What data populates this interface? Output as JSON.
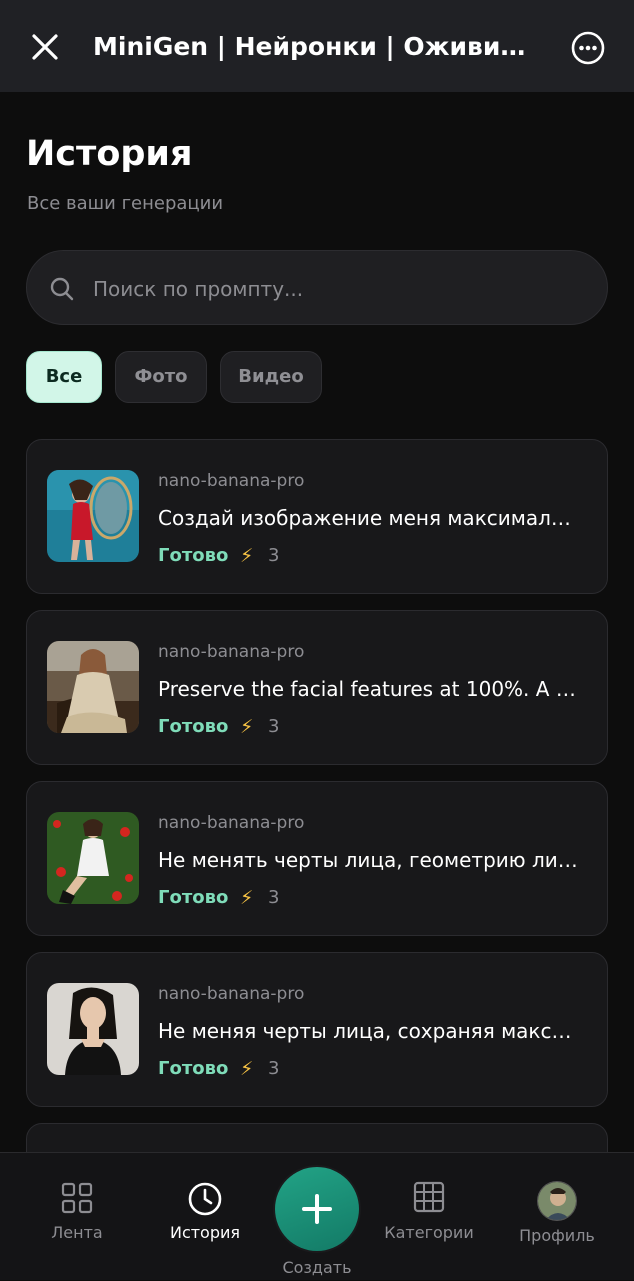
{
  "header": {
    "title": "MiniGen | Нейронки | Оживить…",
    "close_icon": "close-icon",
    "more_icon": "more-options-icon"
  },
  "page": {
    "title": "История",
    "subtitle": "Все ваши генерации"
  },
  "search": {
    "placeholder": "Поиск по промпту..."
  },
  "filters": [
    {
      "label": "Все",
      "active": true
    },
    {
      "label": "Фото",
      "active": false
    },
    {
      "label": "Видео",
      "active": false
    }
  ],
  "generations": [
    {
      "model": "nano-banana-pro",
      "prompt": "Создай изображение меня максимал…",
      "status": "Готово",
      "cost": "3"
    },
    {
      "model": "nano-banana-pro",
      "prompt": "Preserve the facial features at 100%. A …",
      "status": "Готово",
      "cost": "3"
    },
    {
      "model": "nano-banana-pro",
      "prompt": "Не менять черты лица, геометрию ли…",
      "status": "Готово",
      "cost": "3"
    },
    {
      "model": "nano-banana-pro",
      "prompt": "Не меняя черты лица, сохраняя макс…",
      "status": "Готово",
      "cost": "3"
    }
  ],
  "nav": {
    "feed": "Лента",
    "history": "История",
    "create": "Создать",
    "categories": "Категории",
    "profile": "Профиль"
  },
  "colors": {
    "accent": "#7fdcb9",
    "active_chip_bg": "#d2f6e8",
    "fab": "#1a8f76",
    "bolt": "#f6c244"
  }
}
